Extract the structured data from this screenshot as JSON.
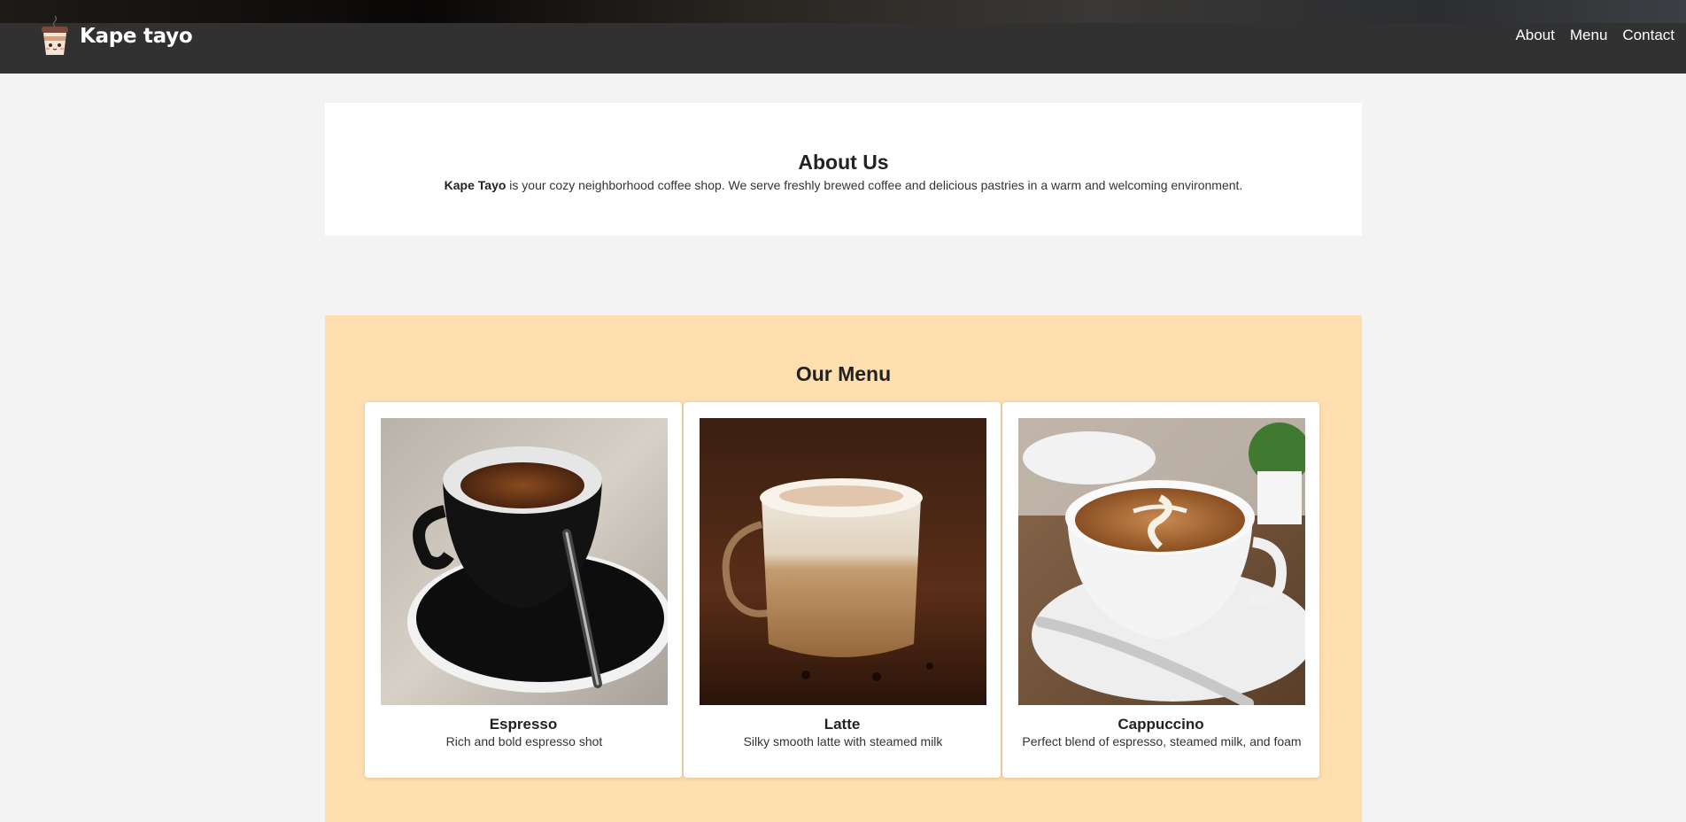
{
  "brand": {
    "name": "Kape tayo",
    "logo_icon": "coffee-cup-mascot-icon"
  },
  "nav": {
    "items": [
      "About",
      "Menu",
      "Contact"
    ]
  },
  "about": {
    "title": "About Us",
    "brand_strong": "Kape Tayo",
    "text": " is your cozy neighborhood coffee shop. We serve freshly brewed coffee and delicious pastries in a warm and welcoming environment."
  },
  "menu": {
    "title": "Our Menu",
    "items": [
      {
        "name": "Espresso",
        "description": "Rich and bold espresso shot",
        "image": "espresso-photo"
      },
      {
        "name": "Latte",
        "description": "Silky smooth latte with steamed milk",
        "image": "latte-photo"
      },
      {
        "name": "Cappuccino",
        "description": "Perfect blend of espresso, steamed milk, and foam",
        "image": "cappuccino-photo"
      }
    ]
  },
  "colors": {
    "navbar": "#313131",
    "page_background": "#f3f3f3",
    "menu_background": "#ffdfb0",
    "card_background": "#ffffff"
  }
}
